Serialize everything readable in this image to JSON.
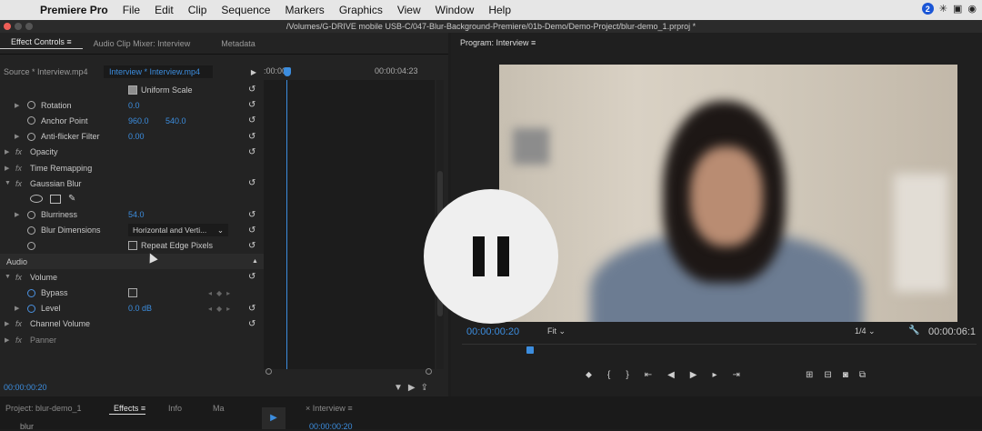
{
  "menubar": {
    "items": [
      "Premiere Pro",
      "File",
      "Edit",
      "Clip",
      "Sequence",
      "Markers",
      "Graphics",
      "View",
      "Window",
      "Help"
    ],
    "badge": "2"
  },
  "window_title": "/Volumes/G-DRIVE mobile USB-C/047-Blur-Background-Premiere/01b-Demo/Demo-Project/blur-demo_1.prproj *",
  "effect_controls": {
    "tabs": [
      "Effect Controls",
      "Audio Clip Mixer: Interview",
      "Metadata"
    ],
    "source_label": "Source * Interview.mp4",
    "clip_label": "Interview * Interview.mp4",
    "time_start": ":00:00",
    "time_end": "00:00:04:23",
    "uniform_scale": "Uniform Scale",
    "rotation": {
      "label": "Rotation",
      "value": "0.0"
    },
    "anchor_point": {
      "label": "Anchor Point",
      "x": "960.0",
      "y": "540.0"
    },
    "anti_flicker": {
      "label": "Anti-flicker Filter",
      "value": "0.00"
    },
    "opacity": "Opacity",
    "time_remapping": "Time Remapping",
    "gaussian_blur": "Gaussian Blur",
    "blurriness": {
      "label": "Blurriness",
      "value": "54.0"
    },
    "blur_dimensions": {
      "label": "Blur Dimensions",
      "value": "Horizontal and Verti..."
    },
    "repeat_edge": "Repeat Edge Pixels",
    "audio_header": "Audio",
    "volume": "Volume",
    "bypass": "Bypass",
    "level": {
      "label": "Level",
      "value": "0.0 dB"
    },
    "channel_volume": "Channel Volume",
    "panner": "Panner",
    "timecode": "00:00:00:20"
  },
  "program": {
    "tab": "Program: Interview",
    "timecode": "00:00:00:20",
    "fit": "Fit",
    "quality": "1/4",
    "duration": "00:00:06:1"
  },
  "bottom": {
    "project": "Project: blur-demo_1",
    "effects": "Effects",
    "info": "Info",
    "ma": "Ma",
    "seq_tab": "Interview",
    "seq_tc": "00:00:00:20",
    "search": "blur"
  }
}
